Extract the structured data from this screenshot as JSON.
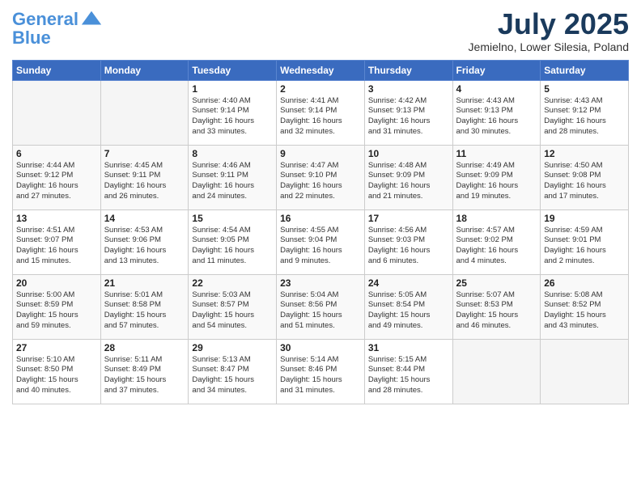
{
  "header": {
    "logo_line1": "General",
    "logo_line2": "Blue",
    "month": "July 2025",
    "location": "Jemielno, Lower Silesia, Poland"
  },
  "weekdays": [
    "Sunday",
    "Monday",
    "Tuesday",
    "Wednesday",
    "Thursday",
    "Friday",
    "Saturday"
  ],
  "weeks": [
    [
      {
        "day": "",
        "info": ""
      },
      {
        "day": "",
        "info": ""
      },
      {
        "day": "1",
        "info": "Sunrise: 4:40 AM\nSunset: 9:14 PM\nDaylight: 16 hours\nand 33 minutes."
      },
      {
        "day": "2",
        "info": "Sunrise: 4:41 AM\nSunset: 9:14 PM\nDaylight: 16 hours\nand 32 minutes."
      },
      {
        "day": "3",
        "info": "Sunrise: 4:42 AM\nSunset: 9:13 PM\nDaylight: 16 hours\nand 31 minutes."
      },
      {
        "day": "4",
        "info": "Sunrise: 4:43 AM\nSunset: 9:13 PM\nDaylight: 16 hours\nand 30 minutes."
      },
      {
        "day": "5",
        "info": "Sunrise: 4:43 AM\nSunset: 9:12 PM\nDaylight: 16 hours\nand 28 minutes."
      }
    ],
    [
      {
        "day": "6",
        "info": "Sunrise: 4:44 AM\nSunset: 9:12 PM\nDaylight: 16 hours\nand 27 minutes."
      },
      {
        "day": "7",
        "info": "Sunrise: 4:45 AM\nSunset: 9:11 PM\nDaylight: 16 hours\nand 26 minutes."
      },
      {
        "day": "8",
        "info": "Sunrise: 4:46 AM\nSunset: 9:11 PM\nDaylight: 16 hours\nand 24 minutes."
      },
      {
        "day": "9",
        "info": "Sunrise: 4:47 AM\nSunset: 9:10 PM\nDaylight: 16 hours\nand 22 minutes."
      },
      {
        "day": "10",
        "info": "Sunrise: 4:48 AM\nSunset: 9:09 PM\nDaylight: 16 hours\nand 21 minutes."
      },
      {
        "day": "11",
        "info": "Sunrise: 4:49 AM\nSunset: 9:09 PM\nDaylight: 16 hours\nand 19 minutes."
      },
      {
        "day": "12",
        "info": "Sunrise: 4:50 AM\nSunset: 9:08 PM\nDaylight: 16 hours\nand 17 minutes."
      }
    ],
    [
      {
        "day": "13",
        "info": "Sunrise: 4:51 AM\nSunset: 9:07 PM\nDaylight: 16 hours\nand 15 minutes."
      },
      {
        "day": "14",
        "info": "Sunrise: 4:53 AM\nSunset: 9:06 PM\nDaylight: 16 hours\nand 13 minutes."
      },
      {
        "day": "15",
        "info": "Sunrise: 4:54 AM\nSunset: 9:05 PM\nDaylight: 16 hours\nand 11 minutes."
      },
      {
        "day": "16",
        "info": "Sunrise: 4:55 AM\nSunset: 9:04 PM\nDaylight: 16 hours\nand 9 minutes."
      },
      {
        "day": "17",
        "info": "Sunrise: 4:56 AM\nSunset: 9:03 PM\nDaylight: 16 hours\nand 6 minutes."
      },
      {
        "day": "18",
        "info": "Sunrise: 4:57 AM\nSunset: 9:02 PM\nDaylight: 16 hours\nand 4 minutes."
      },
      {
        "day": "19",
        "info": "Sunrise: 4:59 AM\nSunset: 9:01 PM\nDaylight: 16 hours\nand 2 minutes."
      }
    ],
    [
      {
        "day": "20",
        "info": "Sunrise: 5:00 AM\nSunset: 8:59 PM\nDaylight: 15 hours\nand 59 minutes."
      },
      {
        "day": "21",
        "info": "Sunrise: 5:01 AM\nSunset: 8:58 PM\nDaylight: 15 hours\nand 57 minutes."
      },
      {
        "day": "22",
        "info": "Sunrise: 5:03 AM\nSunset: 8:57 PM\nDaylight: 15 hours\nand 54 minutes."
      },
      {
        "day": "23",
        "info": "Sunrise: 5:04 AM\nSunset: 8:56 PM\nDaylight: 15 hours\nand 51 minutes."
      },
      {
        "day": "24",
        "info": "Sunrise: 5:05 AM\nSunset: 8:54 PM\nDaylight: 15 hours\nand 49 minutes."
      },
      {
        "day": "25",
        "info": "Sunrise: 5:07 AM\nSunset: 8:53 PM\nDaylight: 15 hours\nand 46 minutes."
      },
      {
        "day": "26",
        "info": "Sunrise: 5:08 AM\nSunset: 8:52 PM\nDaylight: 15 hours\nand 43 minutes."
      }
    ],
    [
      {
        "day": "27",
        "info": "Sunrise: 5:10 AM\nSunset: 8:50 PM\nDaylight: 15 hours\nand 40 minutes."
      },
      {
        "day": "28",
        "info": "Sunrise: 5:11 AM\nSunset: 8:49 PM\nDaylight: 15 hours\nand 37 minutes."
      },
      {
        "day": "29",
        "info": "Sunrise: 5:13 AM\nSunset: 8:47 PM\nDaylight: 15 hours\nand 34 minutes."
      },
      {
        "day": "30",
        "info": "Sunrise: 5:14 AM\nSunset: 8:46 PM\nDaylight: 15 hours\nand 31 minutes."
      },
      {
        "day": "31",
        "info": "Sunrise: 5:15 AM\nSunset: 8:44 PM\nDaylight: 15 hours\nand 28 minutes."
      },
      {
        "day": "",
        "info": ""
      },
      {
        "day": "",
        "info": ""
      }
    ]
  ]
}
